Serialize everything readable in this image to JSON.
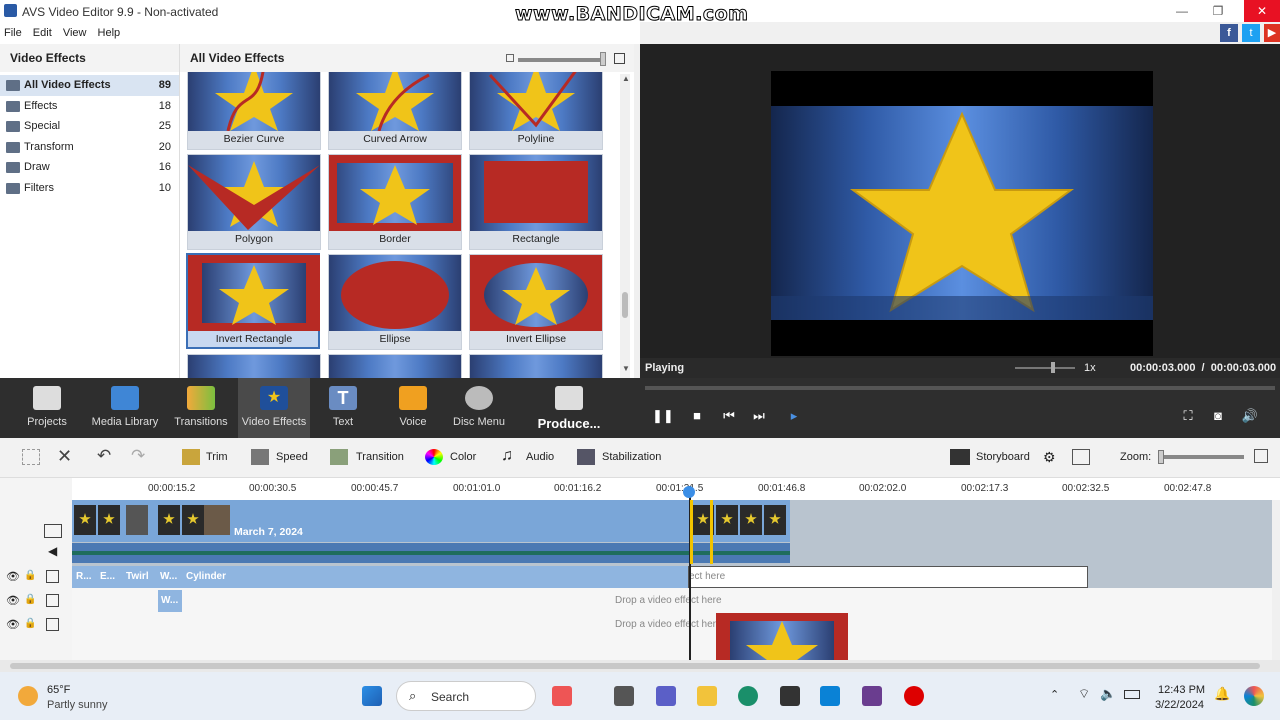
{
  "window": {
    "title": "AVS Video Editor 9.9 - Non-activated",
    "watermark": "www.BANDICAM.com"
  },
  "menu": [
    "File",
    "Edit",
    "View",
    "Help"
  ],
  "sidebar": {
    "header": "Video Effects",
    "items": [
      {
        "label": "All Video Effects",
        "count": "89"
      },
      {
        "label": "Effects",
        "count": "18"
      },
      {
        "label": "Special",
        "count": "25"
      },
      {
        "label": "Transform",
        "count": "20"
      },
      {
        "label": "Draw",
        "count": "16"
      },
      {
        "label": "Filters",
        "count": "10"
      }
    ]
  },
  "effects": {
    "header": "All Video Effects",
    "tiles": [
      {
        "label": "Bezier Curve"
      },
      {
        "label": "Curved Arrow"
      },
      {
        "label": "Polyline"
      },
      {
        "label": "Polygon"
      },
      {
        "label": "Border"
      },
      {
        "label": "Rectangle"
      },
      {
        "label": "Invert Rectangle"
      },
      {
        "label": "Ellipse"
      },
      {
        "label": "Invert Ellipse"
      }
    ]
  },
  "preview": {
    "status": "Playing",
    "speed": "1x",
    "time": "00:00:03.000  /  00:00:03.000"
  },
  "toolbar": {
    "items": [
      {
        "label": "Projects",
        "icon": "projects-icon"
      },
      {
        "label": "Media Library",
        "icon": "media-library-icon"
      },
      {
        "label": "Transitions",
        "icon": "transitions-icon"
      },
      {
        "label": "Video Effects",
        "icon": "video-effects-icon"
      },
      {
        "label": "Text",
        "icon": "text-icon"
      },
      {
        "label": "Voice",
        "icon": "voice-icon"
      },
      {
        "label": "Disc Menu",
        "icon": "disc-menu-icon"
      },
      {
        "label": "Produce...",
        "icon": "produce-icon"
      }
    ]
  },
  "edit_tools": {
    "trim": "Trim",
    "speed": "Speed",
    "transition": "Transition",
    "color": "Color",
    "audio": "Audio",
    "stabilization": "Stabilization",
    "storyboard": "Storyboard",
    "zoom": "Zoom:"
  },
  "timeline": {
    "ticks": [
      "00:00:15.2",
      "00:00:30.5",
      "00:00:45.7",
      "00:01:01.0",
      "00:01:16.2",
      "00:01:31.5",
      "00:01:46.8",
      "00:02:02.0",
      "00:02:17.3",
      "00:02:32.5",
      "00:02:47.8"
    ],
    "clip_date": "March 7, 2024",
    "fx_clips": [
      "R...",
      "E...",
      "Twirl",
      "W...",
      "Cylinder"
    ],
    "fx2_clip": "W...",
    "drop_hint_1": "ect here",
    "drop_hint_2": "Drop a video effect here",
    "drop_hint_3": "Drop a video effect here"
  },
  "taskbar": {
    "temp": "65°F",
    "weather": "Partly sunny",
    "search": "Search",
    "time": "12:43 PM",
    "date": "3/22/2024"
  },
  "colors": {
    "accent": "#3b6fb6",
    "effect_red": "#b72a24",
    "star": "#f0c419"
  }
}
